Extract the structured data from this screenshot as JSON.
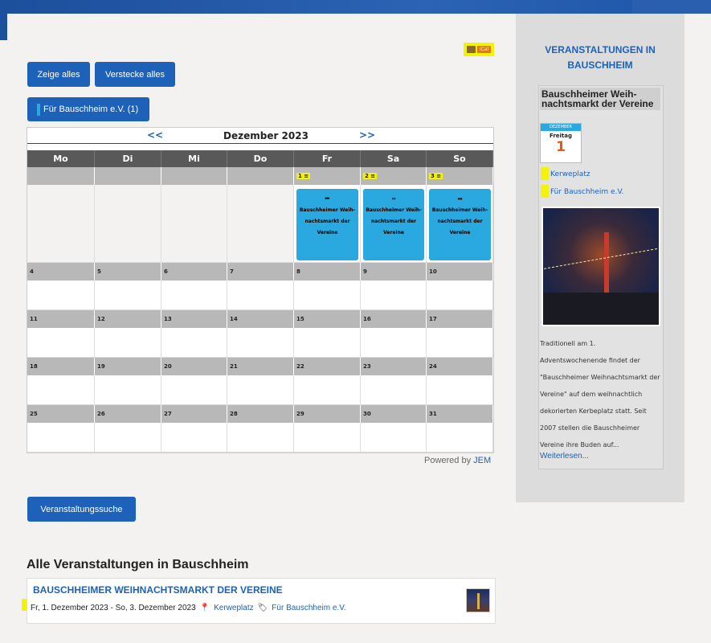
{
  "colors": {
    "accent": "#1e61b8",
    "event": "#2aa8e0",
    "highlight": "#f2f20a",
    "header_row": "#595959"
  },
  "ical": {
    "badge": "iCal"
  },
  "buttons": {
    "show_all": "Zeige alles",
    "hide_all": "Verstecke alles",
    "category": "Für Bauschheim e.V. (1)",
    "search": "Veranstaltungssuche"
  },
  "calendar": {
    "prev": "<<",
    "next": ">>",
    "title": "Dezember 2023",
    "weekdays": [
      "Mo",
      "Di",
      "Mi",
      "Do",
      "Fr",
      "Sa",
      "So"
    ],
    "weeks": [
      [
        "",
        "",
        "",
        "",
        "1",
        "2",
        "3"
      ],
      [
        "4",
        "5",
        "6",
        "7",
        "8",
        "9",
        "10"
      ],
      [
        "11",
        "12",
        "13",
        "14",
        "15",
        "16",
        "17"
      ],
      [
        "18",
        "19",
        "20",
        "21",
        "22",
        "23",
        "24"
      ],
      [
        "25",
        "26",
        "27",
        "28",
        "29",
        "30",
        "31"
      ]
    ],
    "events": [
      {
        "day": "1",
        "icon": "⏮",
        "title": "Bauschheimer Weih- nachtsmarkt der Vereine"
      },
      {
        "day": "2",
        "icon": "↔",
        "title": "Bauschheimer Weih- nachtsmarkt der Vereine"
      },
      {
        "day": "3",
        "icon": "⏭",
        "title": "Bauschheimer Weih- nachtsmarkt der Vereine"
      }
    ],
    "powered_prefix": "Powered by",
    "powered_link": "JEM"
  },
  "list": {
    "heading": "Alle Veranstaltungen in Bauschheim",
    "item": {
      "title": "BAUSCHHEIMER WEIHNACHTSMARKT DER VEREINE",
      "dates": "Fr, 1. Dezember 2023 - So, 3. Dezember 2023",
      "location": "Kerweplatz",
      "category": "Für Bauschheim e.V."
    }
  },
  "sidebar": {
    "heading": "VERANSTALTUNGEN IN BAUSCHHEIM",
    "event_title": "Bauschheimer Weih- nachtsmarkt der Vereine",
    "cal_month": "DEZEMBER",
    "cal_weekday": "Freitag",
    "cal_day": "1",
    "location": "Kerweplatz",
    "category": "Für Bauschheim e.V.",
    "description": "Traditionell am 1. Adventswochenende findet der \"Bauschheimer Weihnachtsmarkt der Vereine\" auf dem weihnachtlich dekorierten Kerbeplatz statt. Seit 2007 stellen die Bauschheimer Vereine ihre Buden auf...",
    "more": "Weiterlesen..."
  }
}
